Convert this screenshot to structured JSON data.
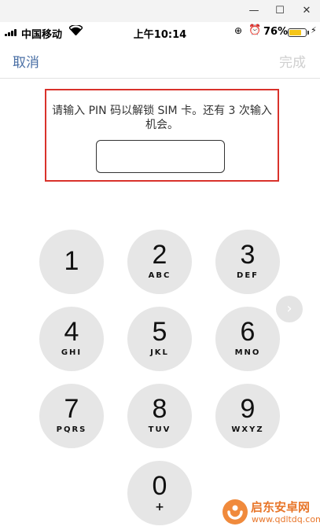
{
  "window": {
    "controls": {
      "minimize": "—",
      "maximize": "☐",
      "close": "✕"
    }
  },
  "status_bar": {
    "carrier": "中国移动",
    "time": "上午10:14",
    "battery_percent": "76%",
    "battery_level": 0.76,
    "battery_color": "#f5c518"
  },
  "nav": {
    "cancel": "取消",
    "done": "完成",
    "cancel_color": "#4a6fa5",
    "done_color": "#cfcfcf"
  },
  "prompt": {
    "message": "请输入 PIN 码以解锁 SIM 卡。还有 3 次输入机会。",
    "pin_value": "",
    "highlight_color": "#d9322b"
  },
  "keypad": {
    "keys": [
      {
        "digit": "1",
        "letters": ""
      },
      {
        "digit": "2",
        "letters": "ABC"
      },
      {
        "digit": "3",
        "letters": "DEF"
      },
      {
        "digit": "4",
        "letters": "GHI"
      },
      {
        "digit": "5",
        "letters": "JKL"
      },
      {
        "digit": "6",
        "letters": "MNO"
      },
      {
        "digit": "7",
        "letters": "PQRS"
      },
      {
        "digit": "8",
        "letters": "TUV"
      },
      {
        "digit": "9",
        "letters": "WXYZ"
      },
      {
        "digit": "0",
        "letters": "+"
      }
    ]
  },
  "watermark": {
    "brand": "启东安卓网",
    "url": "www.qdltdq.com",
    "color": "#e8762a"
  }
}
